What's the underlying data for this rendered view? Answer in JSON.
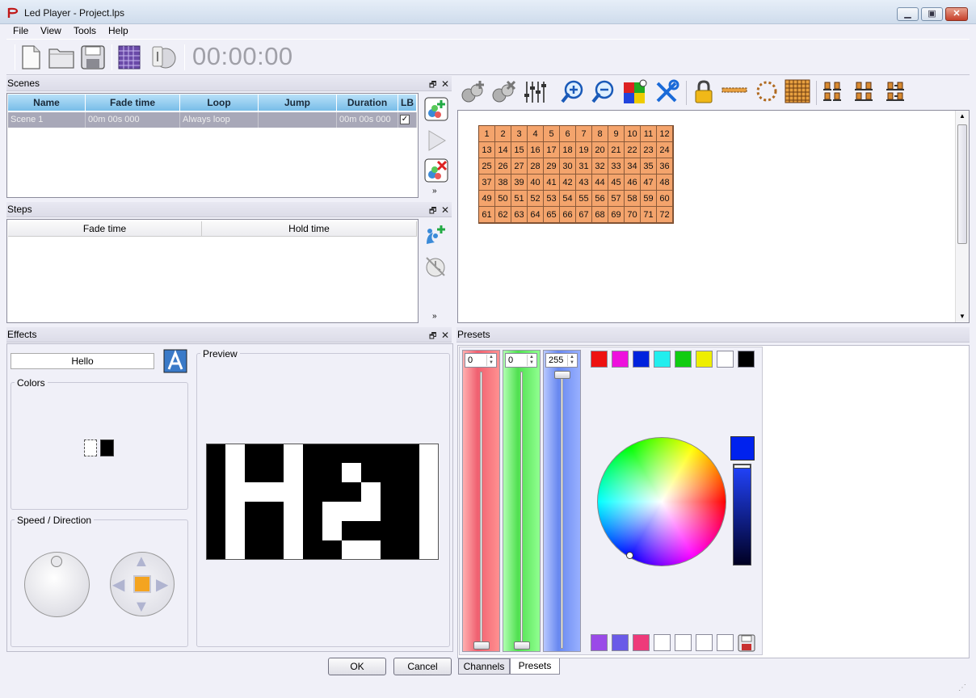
{
  "window": {
    "title": "Led Player - Project.lps"
  },
  "menu": [
    "File",
    "View",
    "Tools",
    "Help"
  ],
  "toolbar": {
    "icons": [
      "new-file-icon",
      "open-folder-icon",
      "save-icon",
      "led-matrix-icon",
      "info-icon"
    ],
    "time": "00:00:00"
  },
  "scenes": {
    "title": "Scenes",
    "columns": [
      "Name",
      "Fade time",
      "Loop",
      "Jump",
      "Duration",
      "LB"
    ],
    "rows": [
      {
        "name": "Scene 1",
        "fade_time": "00m 00s 000",
        "loop": "Always loop",
        "jump": "",
        "duration": "00m 00s 000",
        "lb": "✓"
      }
    ]
  },
  "steps": {
    "title": "Steps",
    "columns": [
      "Fade time",
      "Hold time"
    ]
  },
  "effects": {
    "title": "Effects",
    "text_value": "Hello",
    "colors_label": "Colors",
    "speed_label": "Speed / Direction",
    "preview_label": "Preview",
    "ok_label": "OK",
    "cancel_label": "Cancel"
  },
  "grid": {
    "numbers": [
      "1",
      "2",
      "3",
      "4",
      "5",
      "6",
      "7",
      "8",
      "9",
      "10",
      "11",
      "12",
      "13",
      "14",
      "15",
      "16",
      "17",
      "18",
      "19",
      "20",
      "21",
      "22",
      "23",
      "24",
      "25",
      "26",
      "27",
      "28",
      "29",
      "30",
      "31",
      "32",
      "33",
      "34",
      "35",
      "36",
      "37",
      "38",
      "39",
      "40",
      "41",
      "42",
      "43",
      "44",
      "45",
      "46",
      "47",
      "48",
      "49",
      "50",
      "51",
      "52",
      "53",
      "54",
      "55",
      "56",
      "57",
      "58",
      "59",
      "60",
      "61",
      "62",
      "63",
      "64",
      "65",
      "66",
      "67",
      "68",
      "69",
      "70",
      "71",
      "72"
    ]
  },
  "presets": {
    "title": "Presets",
    "red_value": "0",
    "green_value": "0",
    "blue_value": "255",
    "top_swatches": [
      "#ee1111",
      "#ee11dd",
      "#0022dd",
      "#22eeee",
      "#11cc11",
      "#eeee00",
      "#ffffff",
      "#000000"
    ],
    "bottom_swatches": [
      "#9a4ae8",
      "#6a5ae8",
      "#ee3a7a",
      "#ffffff",
      "#ffffff",
      "#ffffff",
      "#ffffff"
    ],
    "current_color": "#0022ee",
    "tabs": [
      "Channels",
      "Presets"
    ]
  }
}
